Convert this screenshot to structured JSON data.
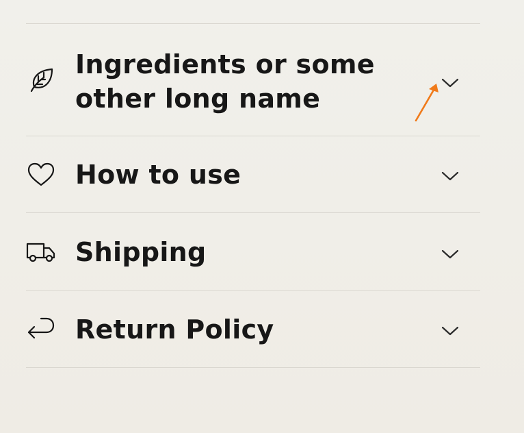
{
  "accordion": {
    "items": [
      {
        "label": "Ingredients or some other long name",
        "icon": "leaf-icon"
      },
      {
        "label": "How to use",
        "icon": "heart-icon"
      },
      {
        "label": "Shipping",
        "icon": "truck-icon"
      },
      {
        "label": "Return Policy",
        "icon": "return-icon"
      }
    ]
  },
  "colors": {
    "background": "#f0eee8",
    "divider": "#d9d6cf",
    "text": "#171717",
    "annotation_arrow": "#f07a1a"
  }
}
